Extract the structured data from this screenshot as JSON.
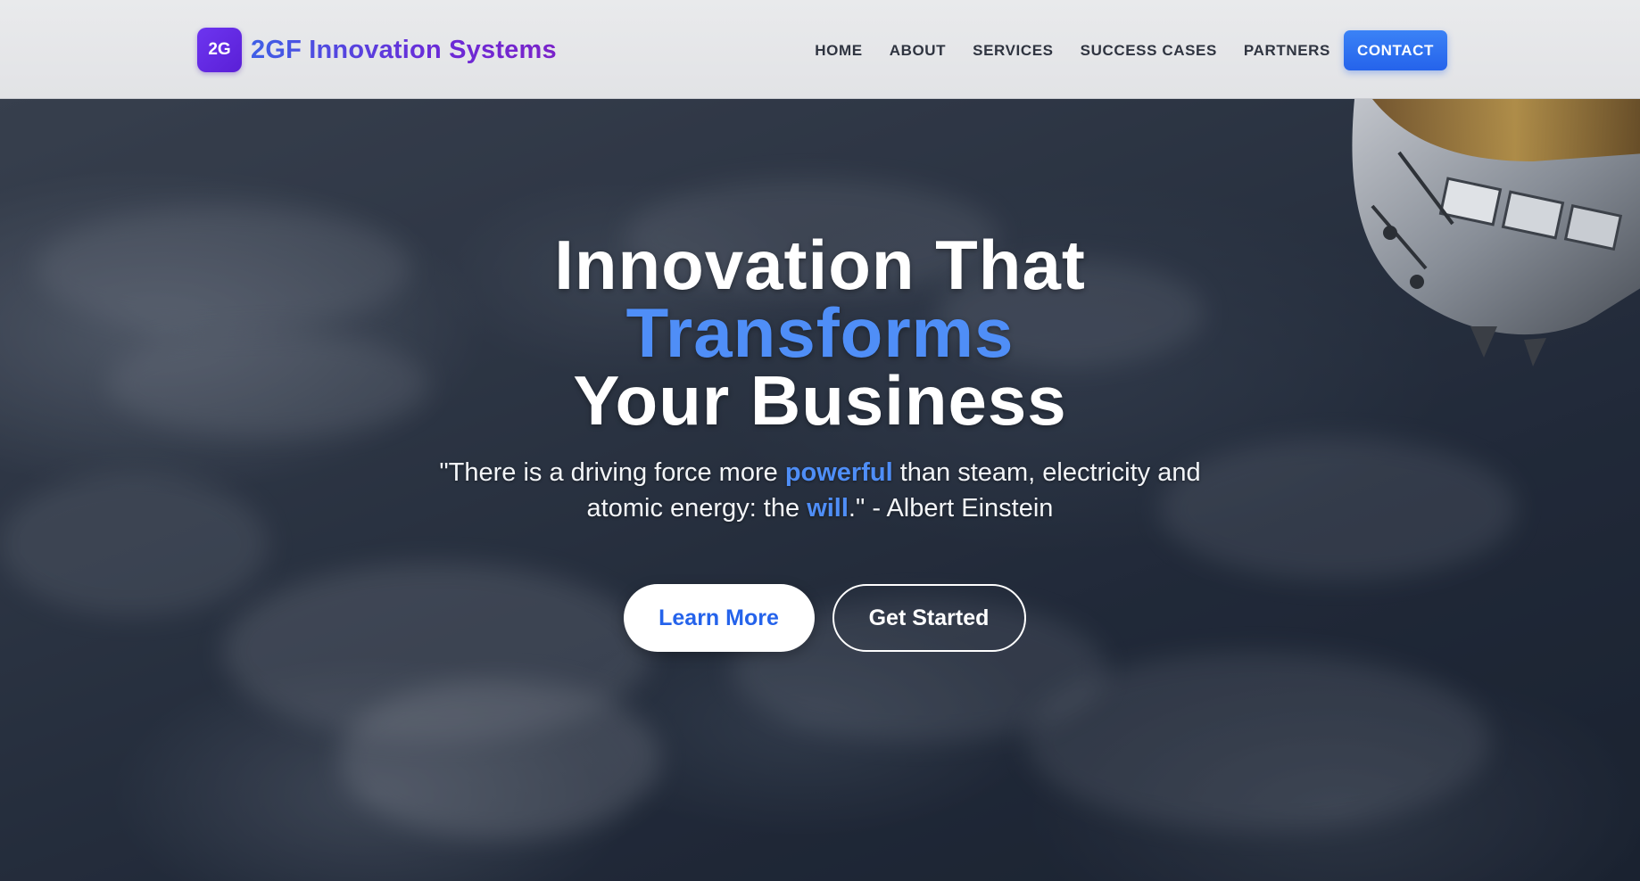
{
  "header": {
    "logo_text": "2G",
    "brand_name": "2GF Innovation Systems",
    "nav": {
      "home": "HOME",
      "about": "ABOUT",
      "services": "SERVICES",
      "success_cases": "SUCCESS CASES",
      "partners": "PARTNERS",
      "contact": "CONTACT"
    }
  },
  "hero": {
    "headline_line1": "Innovation That",
    "headline_line2": "Transforms",
    "headline_line3": "Your Business",
    "quote_part1": "\"There is a driving force more ",
    "quote_hl1": "powerful",
    "quote_part2": " than steam, electricity and atomic energy: the ",
    "quote_hl2": "will",
    "quote_part3": ".\" - Albert Einstein",
    "learn_more": "Learn More",
    "get_started": "Get Started"
  },
  "colors": {
    "accent_blue": "#4f8ef7",
    "button_blue": "#2563eb",
    "brand_purple": "#6a2bd8"
  }
}
